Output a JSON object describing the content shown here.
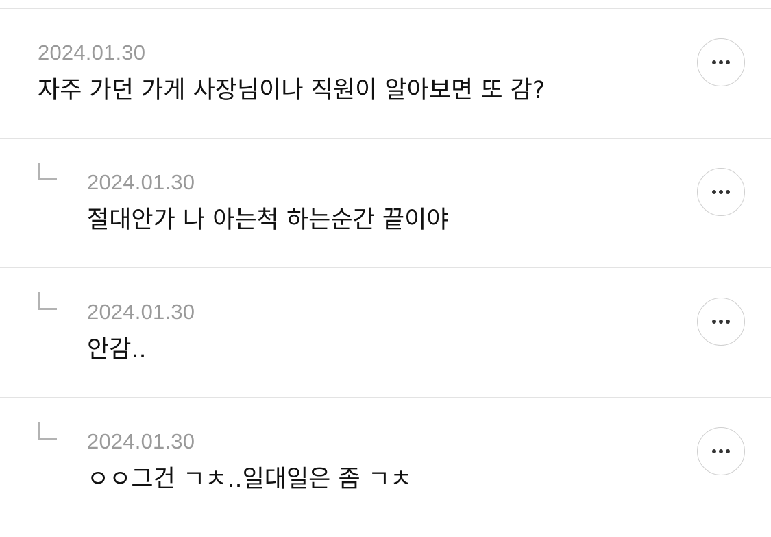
{
  "comments": [
    {
      "is_reply": false,
      "date": "2024.01.30",
      "text": "자주 가던 가게 사장님이나 직원이 알아보면 또 감?",
      "menu_icon": "more-horizontal-icon"
    },
    {
      "is_reply": true,
      "date": "2024.01.30",
      "text": "절대안가 나 아는척 하는순간 끝이야",
      "reply_icon": "reply-arrow-icon",
      "menu_icon": "more-horizontal-icon"
    },
    {
      "is_reply": true,
      "date": "2024.01.30",
      "text": "안감..",
      "reply_icon": "reply-arrow-icon",
      "menu_icon": "more-horizontal-icon"
    },
    {
      "is_reply": true,
      "date": "2024.01.30",
      "text": "ㅇㅇ그건 ㄱㅊ..일대일은 좀 ㄱㅊ",
      "reply_icon": "reply-arrow-icon",
      "menu_icon": "more-horizontal-icon"
    }
  ],
  "colors": {
    "divider": "#e3e3e3",
    "date_text": "#9a9a9a",
    "body_text": "#111111",
    "button_border": "#cfcfcf",
    "reply_arrow": "#b3b3b3",
    "menu_dots": "#333333"
  }
}
